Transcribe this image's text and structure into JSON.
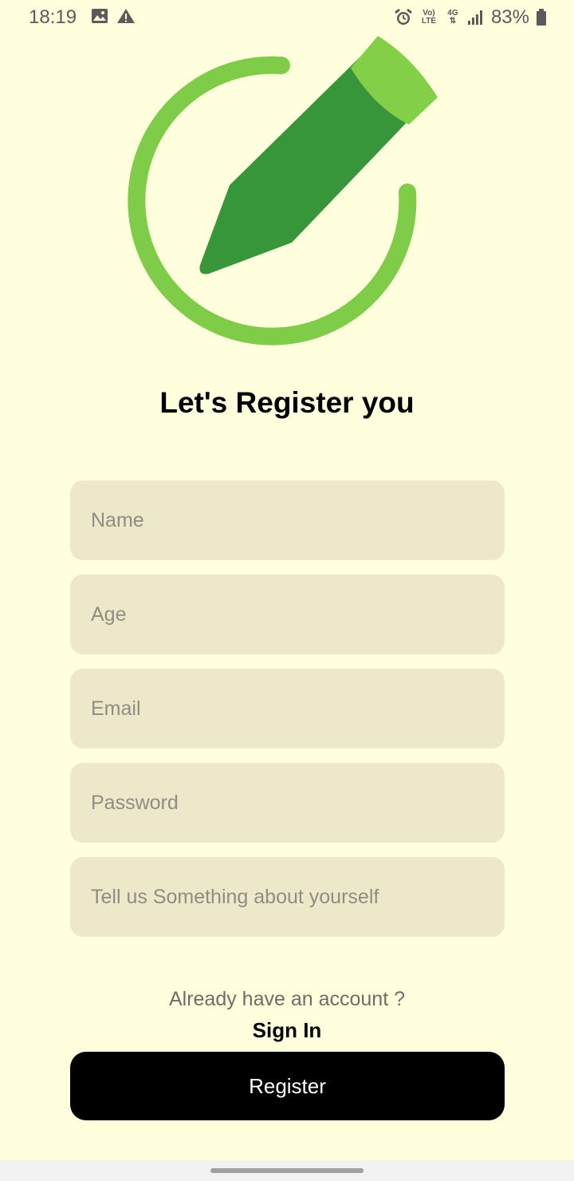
{
  "status_bar": {
    "time": "18:19",
    "network_label": "Vo) LTE",
    "network_type": "4G",
    "battery_percent": "83%",
    "icons": [
      "image-icon",
      "warning-icon",
      "alarm-icon",
      "volte-icon",
      "4g-icon",
      "signal-icon",
      "battery-icon"
    ]
  },
  "hero": {
    "icon": "pencil-circle-icon",
    "colors": {
      "ring": "#7ECC48",
      "pencil_body": "#38963A",
      "pencil_eraser": "#84CF48"
    }
  },
  "page": {
    "title": "Let's Register you"
  },
  "form": {
    "name_placeholder": "Name",
    "age_placeholder": "Age",
    "email_placeholder": "Email",
    "password_placeholder": "Password",
    "about_placeholder": "Tell us Something about yourself"
  },
  "footer": {
    "prompt": "Already have an account ?",
    "signin_label": "Sign In"
  },
  "actions": {
    "register_label": "Register"
  },
  "colors": {
    "background": "#FFFEDD",
    "field_bg": "#EEE8CB",
    "button_bg": "#000000",
    "button_text": "#FFFFFF"
  }
}
